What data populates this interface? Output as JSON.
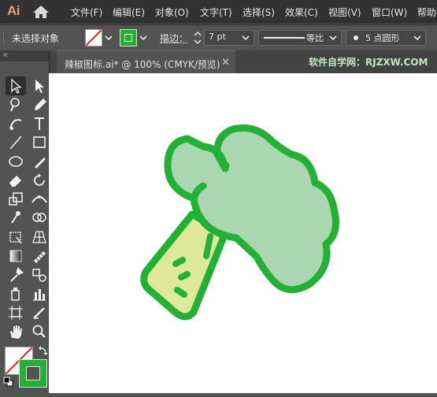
{
  "app": {
    "logo": "Ai"
  },
  "menu": [
    "文件(F)",
    "编辑(E)",
    "对象(O)",
    "文字(T)",
    "选择(S)",
    "效果(C)",
    "视图(V)",
    "窗口(W)",
    "帮助"
  ],
  "control_bar": {
    "selection_status": "未选择对象",
    "stroke_label": "描边：",
    "stroke_value": "7 pt",
    "profile_label": "等比",
    "brush_label": "5 点圆形"
  },
  "document": {
    "tab_label": "辣椒图标.ai* @ 100% (CMYK/预览)",
    "watermark": "软件自学网：RJZXW.COM"
  },
  "colors": {
    "fill": "#22b035",
    "stroke_outline": "#22b035",
    "broccoli_head": "#aad7b2",
    "broccoli_stem": "#dde998"
  },
  "tools": [
    "selection-tool",
    "direct-selection-tool",
    "magic-wand-tool",
    "pen-tool",
    "curvature-tool",
    "type-tool",
    "line-tool",
    "rectangle-tool",
    "ellipse-tool",
    "pencil-tool",
    "eraser-tool",
    "rotate-tool",
    "scale-tool",
    "width-tool",
    "puppet-warp-tool",
    "shape-builder-tool",
    "free-transform-tool",
    "perspective-grid-tool",
    "gradient-tool",
    "mesh-tool",
    "eyedropper-tool",
    "blend-tool",
    "symbol-sprayer-tool",
    "column-graph-tool",
    "artboard-tool",
    "slice-tool",
    "hand-tool",
    "zoom-tool"
  ]
}
